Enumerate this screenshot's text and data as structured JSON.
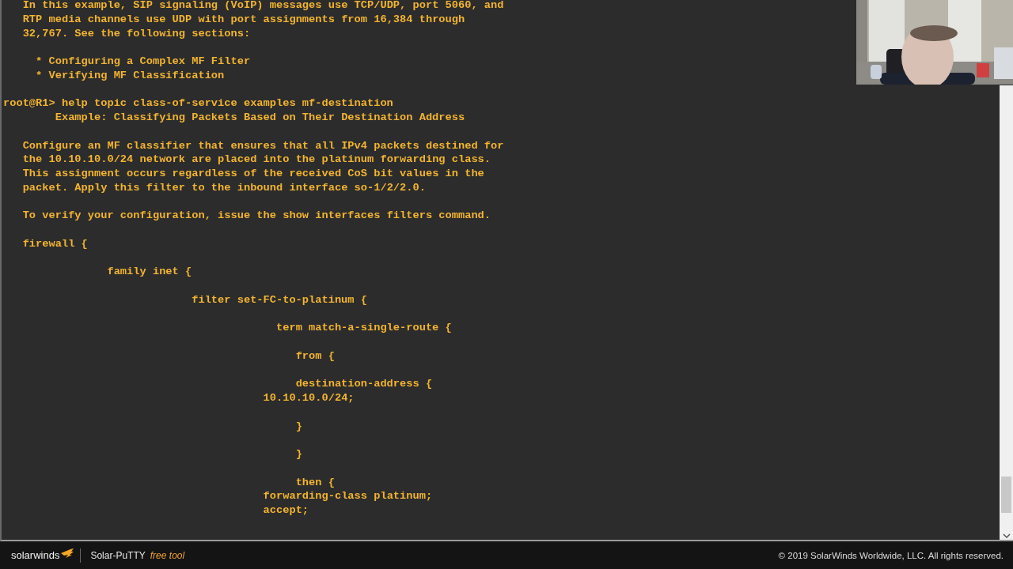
{
  "terminal": {
    "lines": [
      {
        "kind": "text",
        "text": "   In this example, SIP signaling (VoIP) messages use TCP/UDP, port 5060, and"
      },
      {
        "kind": "text",
        "text": "   RTP media channels use UDP with port assignments from 16,384 through"
      },
      {
        "kind": "text",
        "text": "   32,767. See the following sections:"
      },
      {
        "kind": "blank"
      },
      {
        "kind": "text",
        "text": "     * Configuring a Complex MF Filter"
      },
      {
        "kind": "text",
        "text": "     * Verifying MF Classification"
      },
      {
        "kind": "blank"
      },
      {
        "kind": "text",
        "text": "root@R1> help topic class-of-service examples mf-destination"
      },
      {
        "kind": "text",
        "text": "        Example: Classifying Packets Based on Their Destination Address"
      },
      {
        "kind": "blank"
      },
      {
        "kind": "text",
        "text": "   Configure an MF classifier that ensures that all IPv4 packets destined for"
      },
      {
        "kind": "text",
        "text": "   the 10.10.10.0/24 network are placed into the platinum forwarding class."
      },
      {
        "kind": "text",
        "text": "   This assignment occurs regardless of the received CoS bit values in the"
      },
      {
        "kind": "text",
        "text": "   packet. Apply this filter to the inbound interface so-1/2/2.0."
      },
      {
        "kind": "blank"
      },
      {
        "kind": "text",
        "text": "   To verify your configuration, issue the show interfaces filters command."
      },
      {
        "kind": "blank"
      },
      {
        "kind": "text",
        "text": "   firewall {"
      },
      {
        "kind": "blank"
      },
      {
        "kind": "text",
        "text": "                family inet {"
      },
      {
        "kind": "blank"
      },
      {
        "kind": "text",
        "text": "                             filter set-FC-to-platinum {"
      },
      {
        "kind": "blank"
      },
      {
        "kind": "text",
        "text": "                                          term match-a-single-route {"
      },
      {
        "kind": "blank"
      },
      {
        "kind": "text",
        "text": "                                             from {"
      },
      {
        "kind": "blank"
      },
      {
        "kind": "text",
        "text": "                                             destination-address {"
      },
      {
        "kind": "text",
        "text": "                                        10.10.10.0/24;"
      },
      {
        "kind": "blank"
      },
      {
        "kind": "text",
        "text": "                                             }"
      },
      {
        "kind": "blank"
      },
      {
        "kind": "text",
        "text": "                                             }"
      },
      {
        "kind": "blank"
      },
      {
        "kind": "text",
        "text": "                                             then {"
      },
      {
        "kind": "text",
        "text": "                                        forwarding-class platinum;"
      },
      {
        "kind": "text",
        "text": "                                        accept;"
      }
    ]
  },
  "footer": {
    "brand": "solarwinds",
    "app_name": "Solar-PuTTY",
    "app_tag": "free tool",
    "copyright": "© 2019 SolarWinds Worldwide, LLC. All rights reserved."
  }
}
